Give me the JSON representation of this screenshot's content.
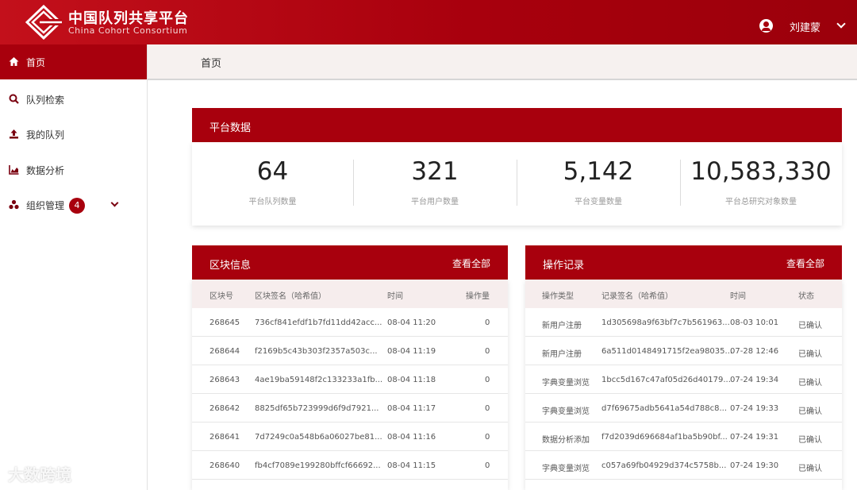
{
  "header": {
    "brand_cn": "中国队列共享平台",
    "brand_en": "China Cohort Consortium",
    "user_name": "刘建蒙"
  },
  "sidebar": {
    "items": [
      {
        "label": "首页",
        "icon": "home-icon"
      },
      {
        "label": "队列检索",
        "icon": "search-icon"
      },
      {
        "label": "我的队列",
        "icon": "upload-icon"
      },
      {
        "label": "数据分析",
        "icon": "chart-icon"
      },
      {
        "label": "组织管理",
        "icon": "org-icon",
        "badge": "4"
      }
    ]
  },
  "breadcrumb": "首页",
  "stats": {
    "title": "平台数据",
    "items": [
      {
        "value": "64",
        "label": "平台队列数量"
      },
      {
        "value": "321",
        "label": "平台用户数量"
      },
      {
        "value": "5,142",
        "label": "平台变量数量"
      },
      {
        "value": "10,583,330",
        "label": "平台总研究对象数量"
      }
    ]
  },
  "blocks": {
    "title": "区块信息",
    "link": "查看全部",
    "columns": [
      "区块号",
      "区块签名（哈希值）",
      "时间",
      "操作量"
    ],
    "rows": [
      [
        "268645",
        "736cf841efdf1b7fd11dd42acc...",
        "08-04 11:20",
        "0"
      ],
      [
        "268644",
        "f2169b5c43b303f2357a503c...",
        "08-04 11:19",
        "0"
      ],
      [
        "268643",
        "4ae19ba59148f2c133233a1fb...",
        "08-04 11:18",
        "0"
      ],
      [
        "268642",
        "8825df65b723999d6f9d7921...",
        "08-04 11:17",
        "0"
      ],
      [
        "268641",
        "7d7249c0a548b6a06027be81...",
        "08-04 11:16",
        "0"
      ],
      [
        "268640",
        "fb4cf7089e199280bffcf66692...",
        "08-04 11:15",
        "0"
      ]
    ]
  },
  "records": {
    "title": "操作记录",
    "link": "查看全部",
    "columns": [
      "操作类型",
      "记录签名（哈希值）",
      "时间",
      "状态"
    ],
    "rows": [
      [
        "新用户注册",
        "1d305698a9f63bf7c7b561963...",
        "08-03 10:01",
        "已确认"
      ],
      [
        "新用户注册",
        "6a511d0148491715f2ea98035...",
        "07-28 12:46",
        "已确认"
      ],
      [
        "字典变量浏览",
        "1bcc5d167c47af05d26d40179...",
        "07-24 19:34",
        "已确认"
      ],
      [
        "字典变量浏览",
        "d7f69675adb5641a54d788c8...",
        "07-24 19:33",
        "已确认"
      ],
      [
        "数据分析添加",
        "f7d2039d696684af1ba5b90bf...",
        "07-24 19:31",
        "已确认"
      ],
      [
        "字典变量浏览",
        "c057a69fb04929d374c5758b...",
        "07-24 19:30",
        "已确认"
      ]
    ]
  },
  "watermark": "大数跨境"
}
